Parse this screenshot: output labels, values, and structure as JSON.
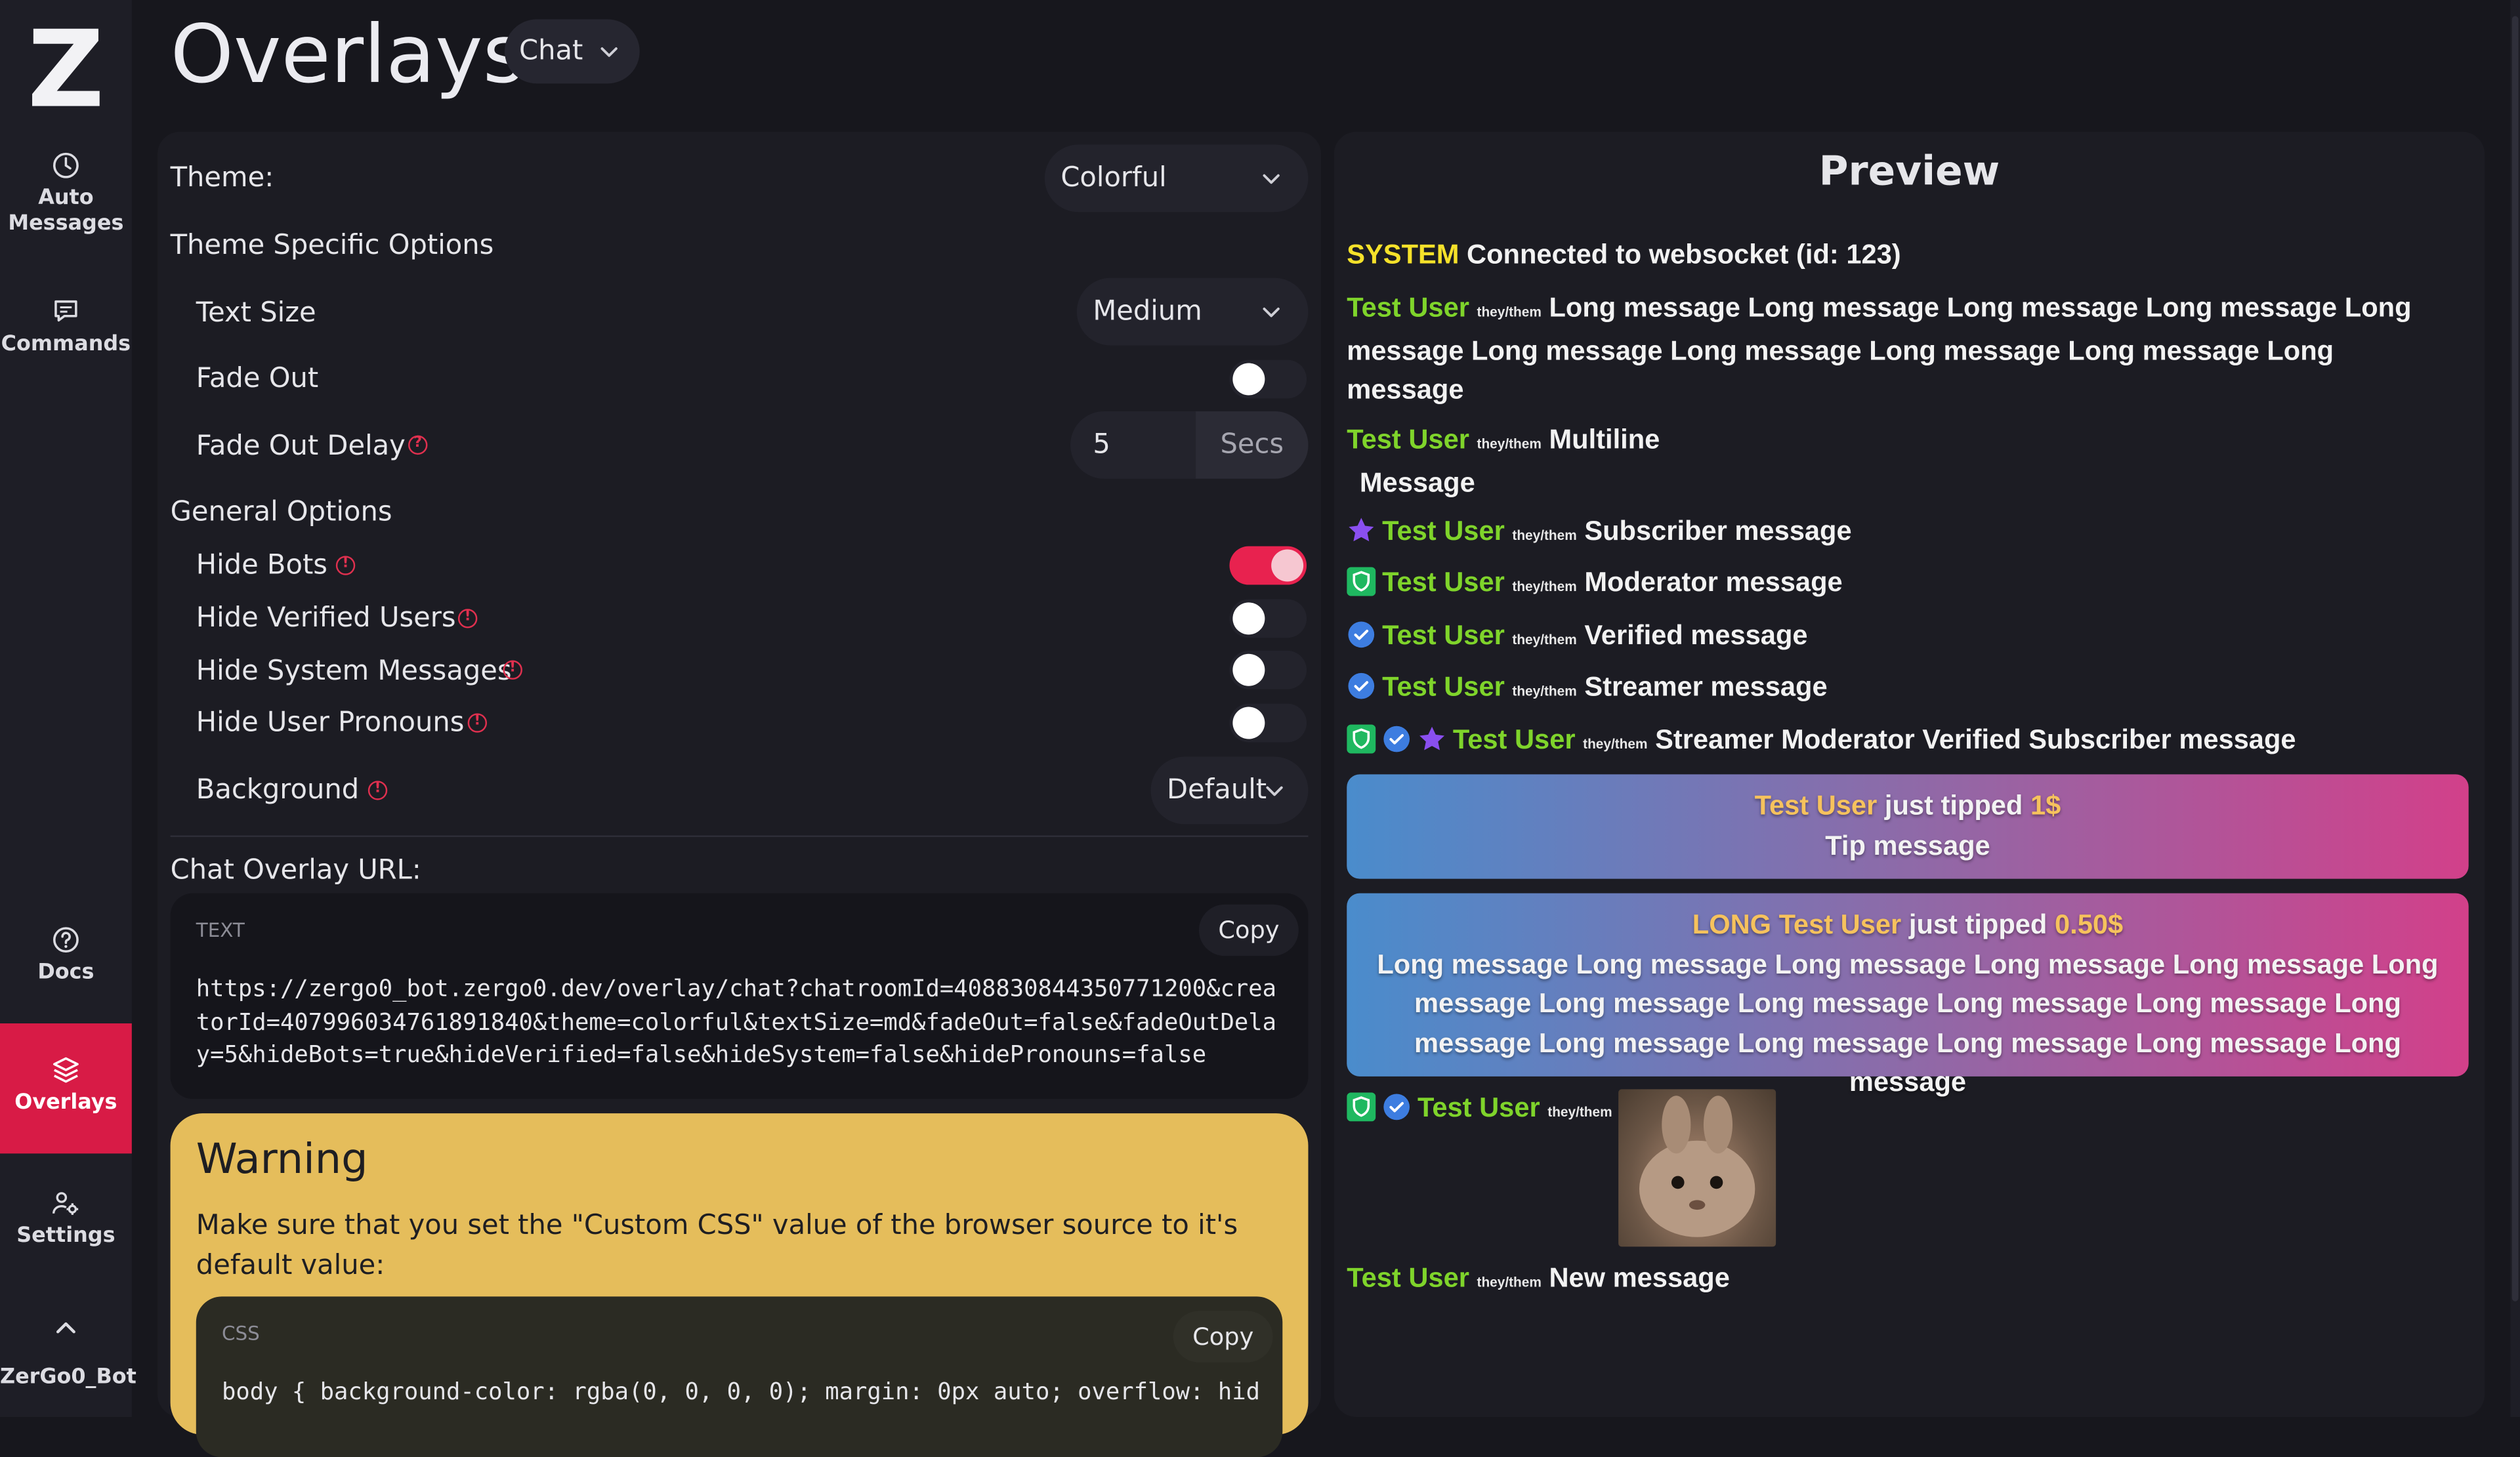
{
  "app": {
    "logo": "Z"
  },
  "sidebar": {
    "items": [
      {
        "label": "Auto Messages",
        "icon": "clock-icon"
      },
      {
        "label": "Commands",
        "icon": "chat-square-icon"
      },
      {
        "label": "Docs",
        "icon": "question-circle-icon"
      },
      {
        "label": "Overlays",
        "icon": "layers-icon",
        "active": true
      },
      {
        "label": "Settings",
        "icon": "people-gear-icon"
      }
    ],
    "user": "ZerGo0_Bot"
  },
  "header": {
    "title": "Overlays",
    "overlay_type": "Chat"
  },
  "settings": {
    "theme_label": "Theme:",
    "theme_value": "Colorful",
    "theme_specific_heading": "Theme Specific Options",
    "text_size_label": "Text Size",
    "text_size_value": "Medium",
    "fade_out_label": "Fade Out",
    "fade_out_on": false,
    "fade_out_delay_label": "Fade Out Delay",
    "fade_out_delay_value": "5",
    "fade_out_delay_unit": "Secs",
    "general_heading": "General Options",
    "hide_bots_label": "Hide Bots",
    "hide_bots_on": true,
    "hide_verified_label": "Hide Verified Users",
    "hide_verified_on": false,
    "hide_system_label": "Hide System Messages",
    "hide_system_on": false,
    "hide_pronouns_label": "Hide User Pronouns",
    "hide_pronouns_on": false,
    "background_label": "Background",
    "background_value": "Default"
  },
  "url_section": {
    "label": "Chat Overlay URL:",
    "tag": "TEXT",
    "copy_label": "Copy",
    "url": "https://zergo0_bot.zergo0.dev/overlay/chat?chatroomId=408830844350771200&creatorId=407996034761891840&theme=colorful&textSize=md&fadeOut=false&fadeOutDelay=5&hideBots=true&hideVerified=false&hideSystem=false&hidePronouns=false"
  },
  "warning": {
    "title": "Warning",
    "text": "Make sure that you set the \"Custom CSS\" value of the browser source to it's default value:",
    "tag": "CSS",
    "copy_label": "Copy",
    "css": "body { background-color: rgba(0, 0, 0, 0); margin: 0px auto; overflow: hid"
  },
  "preview": {
    "title": "Preview",
    "system_name": "SYSTEM",
    "system_text": "Connected to websocket (id: 123)",
    "username": "Test User",
    "pronouns": "they/them",
    "long_text": "Long message Long message Long message Long message Long message Long message Long message Long message Long message Long message",
    "multiline_1": "Multiline",
    "multiline_2": "Message",
    "subscriber_text": "Subscriber message",
    "moderator_text": "Moderator message",
    "verified_text": "Verified message",
    "streamer_text": "Streamer message",
    "combo_text": "Streamer Moderator Verified Subscriber message",
    "tip1_user": "Test User",
    "tip1_mid": "just tipped",
    "tip1_amount": "1$",
    "tip1_text": "Tip message",
    "tip2_user": "LONG Test User",
    "tip2_mid": "just tipped",
    "tip2_amount": "0.50$",
    "tip2_text": "Long message Long message Long message Long message Long message Long message Long message Long message Long message Long message Long message Long message Long message Long message Long message Long message",
    "new_text": "New message"
  },
  "colors": {
    "accent": "#d81b46",
    "username": "#7fd42b",
    "system": "#f5e12a",
    "warning_bg": "#e5bd5b"
  }
}
